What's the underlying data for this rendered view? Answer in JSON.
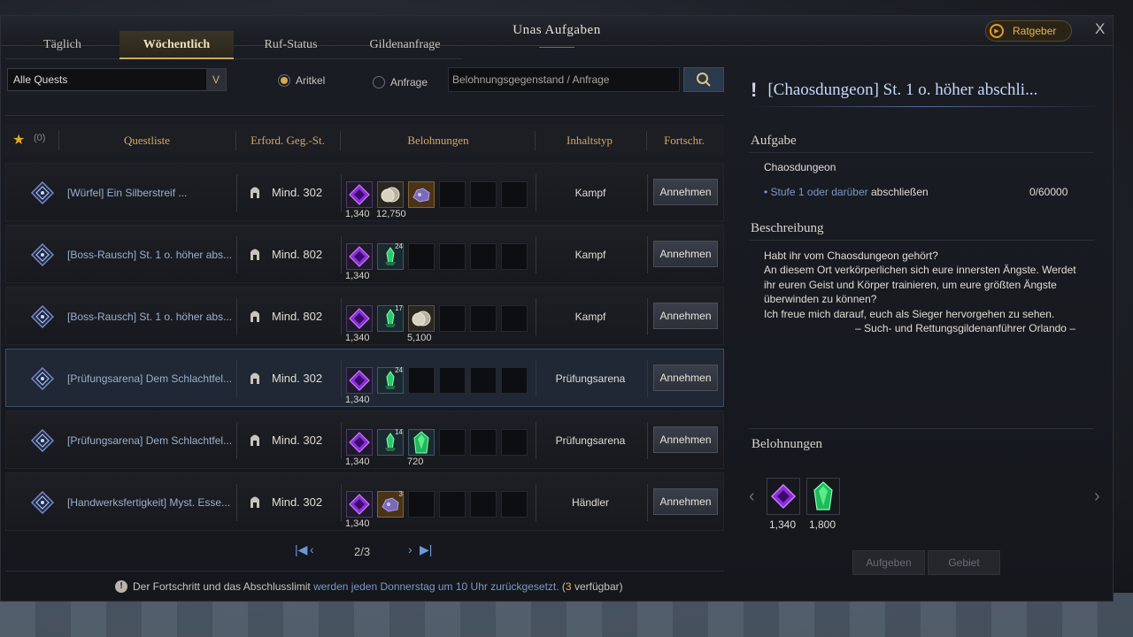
{
  "window": {
    "title": "Unas Aufgaben",
    "advisor_label": "Ratgeber",
    "close_label": "X"
  },
  "tabs": [
    {
      "label": "Täglich",
      "active": false
    },
    {
      "label": "Wöchentlich",
      "active": true
    },
    {
      "label": "Ruf-Status",
      "active": false
    },
    {
      "label": "Gildenanfrage",
      "active": false
    }
  ],
  "filters": {
    "quest_filter": "Alle Quests",
    "radio_item": "Aritkel",
    "radio_request": "Anfrage",
    "radio_selected": "Aritkel",
    "search_placeholder": "Belohnungsgegenstand / Anfrage"
  },
  "table": {
    "favorites_count": "(0)",
    "columns": [
      "Questliste",
      "Erford. Geg.-St.",
      "Belohnungen",
      "Inhaltstyp",
      "Fortschr."
    ],
    "rows": [
      {
        "name": "[Würfel] Ein Silberstreif ...",
        "req": "Mind. 302",
        "rewards": [
          {
            "icon": "purple-gem-icon",
            "amount": "1,340"
          },
          {
            "icon": "silver-coin-icon",
            "amount": "12,750"
          },
          {
            "icon": "ore-icon",
            "amount": ""
          }
        ],
        "type": "Kampf",
        "action": "Annehmen",
        "selected": false
      },
      {
        "name": "[Boss-Rausch] St. 1 o. höher abs...",
        "req": "Mind. 802",
        "rewards": [
          {
            "icon": "purple-gem-icon",
            "amount": "1,340"
          },
          {
            "icon": "green-crystal-icon",
            "amount": "",
            "count": "24"
          }
        ],
        "type": "Kampf",
        "action": "Annehmen",
        "selected": false
      },
      {
        "name": "[Boss-Rausch] St. 1 o. höher abs...",
        "req": "Mind. 802",
        "rewards": [
          {
            "icon": "purple-gem-icon",
            "amount": "1,340"
          },
          {
            "icon": "green-crystal-icon",
            "amount": "",
            "count": "17"
          },
          {
            "icon": "silver-coin-icon",
            "amount": "5,100"
          }
        ],
        "type": "Kampf",
        "action": "Annehmen",
        "selected": false
      },
      {
        "name": "[Prüfungsarena] Dem Schlachtfel...",
        "req": "Mind. 302",
        "rewards": [
          {
            "icon": "purple-gem-icon",
            "amount": "1,340"
          },
          {
            "icon": "green-crystal-icon",
            "amount": "",
            "count": "24"
          }
        ],
        "type": "Prüfungsarena",
        "action": "Annehmen",
        "selected": true
      },
      {
        "name": "[Prüfungsarena] Dem Schlachtfel...",
        "req": "Mind. 302",
        "rewards": [
          {
            "icon": "purple-gem-icon",
            "amount": "1,340"
          },
          {
            "icon": "green-crystal-icon",
            "amount": "",
            "count": "14"
          },
          {
            "icon": "emerald-icon",
            "amount": "720"
          }
        ],
        "type": "Prüfungsarena",
        "action": "Annehmen",
        "selected": false
      },
      {
        "name": "[Handwerksfertigkeit] Myst. Esse...",
        "req": "Mind. 302",
        "rewards": [
          {
            "icon": "purple-gem-icon",
            "amount": "1,340"
          },
          {
            "icon": "ore-icon",
            "amount": "",
            "count": "3"
          }
        ],
        "type": "Händler",
        "action": "Annehmen",
        "selected": false
      }
    ]
  },
  "pagination": {
    "page": "2/3"
  },
  "footer": {
    "part1": "Der Fortschritt und das Abschlusslimit",
    "part2": "werden jeden Donnerstag um 10 Uhr zurückgesetzt.",
    "part3": "(",
    "count": "3",
    "part4": "verfügbar)"
  },
  "detail": {
    "title": "[Chaosdungeon] St. 1 o. höher abschli...",
    "task_heading": "Aufgabe",
    "task_name": "Chaosdungeon",
    "objective_bullet": "•",
    "objective_link": "Stufe 1 oder darüber",
    "objective_rest": "abschließen",
    "objective_progress": "0/60000",
    "desc_heading": "Beschreibung",
    "desc_lines": [
      "Habt ihr vom Chaosdungeon gehört?",
      "An diesem Ort verkörperlichen sich eure innersten Ängste. Werdet",
      "ihr euren Geist und Körper trainieren, um eure größten Ängste",
      "überwinden zu können?",
      "Ich freue mich darauf, euch als Sieger hervorgehen zu sehen."
    ],
    "desc_signature": "– Such- und Rettungsgildenanführer Orlando –",
    "rewards_heading": "Belohnungen",
    "rewards": [
      {
        "icon": "purple-gem-icon",
        "amount": "1,340"
      },
      {
        "icon": "emerald-icon",
        "amount": "1,800"
      }
    ],
    "btn_abandon": "Aufgeben",
    "btn_area": "Gebiet"
  }
}
